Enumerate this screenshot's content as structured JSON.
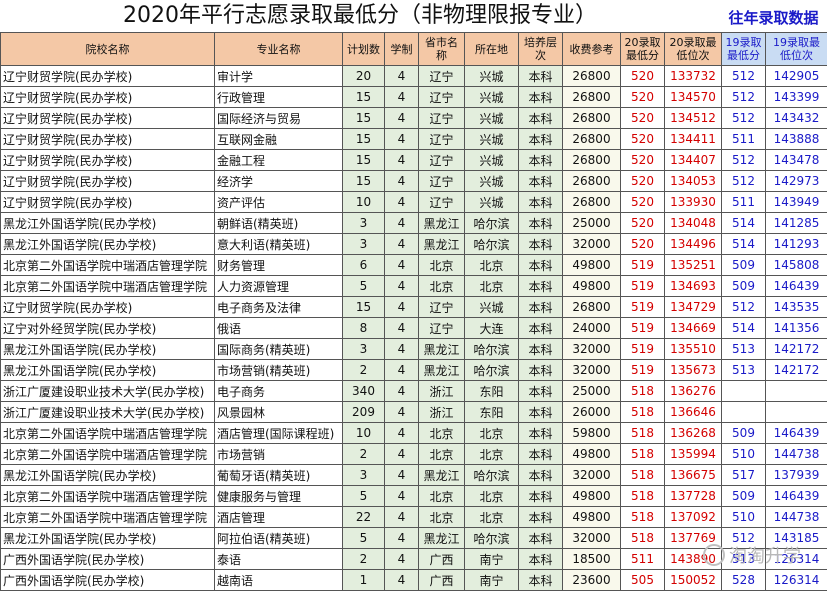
{
  "title": "2020年平行志愿录取最低分（非物理限报专业）",
  "corner_label": "往年录取数据",
  "headers": [
    "院校名称",
    "专业名称",
    "计划数",
    "学制",
    "省市名称",
    "所在地",
    "培养层次",
    "收费参考",
    "20录取最低分",
    "20录取最低位次",
    "19录取最低分",
    "19录取最低位次"
  ],
  "rows": [
    [
      "辽宁财贸学院(民办学校)",
      "审计学",
      "20",
      "4",
      "辽宁",
      "兴城",
      "本科",
      "26800",
      "520",
      "133732",
      "512",
      "142905"
    ],
    [
      "辽宁财贸学院(民办学校)",
      "行政管理",
      "15",
      "4",
      "辽宁",
      "兴城",
      "本科",
      "26800",
      "520",
      "134570",
      "512",
      "143399"
    ],
    [
      "辽宁财贸学院(民办学校)",
      "国际经济与贸易",
      "15",
      "4",
      "辽宁",
      "兴城",
      "本科",
      "26800",
      "520",
      "134512",
      "512",
      "143432"
    ],
    [
      "辽宁财贸学院(民办学校)",
      "互联网金融",
      "15",
      "4",
      "辽宁",
      "兴城",
      "本科",
      "26800",
      "520",
      "134411",
      "511",
      "143888"
    ],
    [
      "辽宁财贸学院(民办学校)",
      "金融工程",
      "15",
      "4",
      "辽宁",
      "兴城",
      "本科",
      "26800",
      "520",
      "134407",
      "512",
      "143478"
    ],
    [
      "辽宁财贸学院(民办学校)",
      "经济学",
      "15",
      "4",
      "辽宁",
      "兴城",
      "本科",
      "26800",
      "520",
      "134053",
      "512",
      "142973"
    ],
    [
      "辽宁财贸学院(民办学校)",
      "资产评估",
      "10",
      "4",
      "辽宁",
      "兴城",
      "本科",
      "26800",
      "520",
      "133930",
      "511",
      "143949"
    ],
    [
      "黑龙江外国语学院(民办学校)",
      "朝鲜语(精英班)",
      "3",
      "4",
      "黑龙江",
      "哈尔滨",
      "本科",
      "25000",
      "520",
      "134048",
      "514",
      "141285"
    ],
    [
      "黑龙江外国语学院(民办学校)",
      "意大利语(精英班)",
      "3",
      "4",
      "黑龙江",
      "哈尔滨",
      "本科",
      "32000",
      "520",
      "134496",
      "514",
      "141293"
    ],
    [
      "北京第二外国语学院中瑞酒店管理学院",
      "财务管理",
      "6",
      "4",
      "北京",
      "北京",
      "本科",
      "49800",
      "519",
      "135251",
      "509",
      "145808"
    ],
    [
      "北京第二外国语学院中瑞酒店管理学院",
      "人力资源管理",
      "5",
      "4",
      "北京",
      "北京",
      "本科",
      "49800",
      "519",
      "134693",
      "509",
      "146439"
    ],
    [
      "辽宁财贸学院(民办学校)",
      "电子商务及法律",
      "15",
      "4",
      "辽宁",
      "兴城",
      "本科",
      "26800",
      "519",
      "134729",
      "512",
      "143535"
    ],
    [
      "辽宁对外经贸学院(民办学校)",
      "俄语",
      "8",
      "4",
      "辽宁",
      "大连",
      "本科",
      "24000",
      "519",
      "134669",
      "514",
      "141356"
    ],
    [
      "黑龙江外国语学院(民办学校)",
      "国际商务(精英班)",
      "3",
      "4",
      "黑龙江",
      "哈尔滨",
      "本科",
      "32000",
      "519",
      "135510",
      "513",
      "142172"
    ],
    [
      "黑龙江外国语学院(民办学校)",
      "市场营销(精英班)",
      "2",
      "4",
      "黑龙江",
      "哈尔滨",
      "本科",
      "32000",
      "519",
      "135673",
      "513",
      "142172"
    ],
    [
      "浙江广厦建设职业技术大学(民办学校)",
      "电子商务",
      "340",
      "4",
      "浙江",
      "东阳",
      "本科",
      "25000",
      "518",
      "136276",
      "",
      ""
    ],
    [
      "浙江广厦建设职业技术大学(民办学校)",
      "风景园林",
      "209",
      "4",
      "浙江",
      "东阳",
      "本科",
      "26000",
      "518",
      "136646",
      "",
      ""
    ],
    [
      "北京第二外国语学院中瑞酒店管理学院",
      "酒店管理(国际课程班)",
      "10",
      "4",
      "北京",
      "北京",
      "本科",
      "59800",
      "518",
      "136268",
      "509",
      "146439"
    ],
    [
      "北京第二外国语学院中瑞酒店管理学院",
      "市场营销",
      "2",
      "4",
      "北京",
      "北京",
      "本科",
      "49800",
      "518",
      "135994",
      "510",
      "144738"
    ],
    [
      "黑龙江外国语学院(民办学校)",
      "葡萄牙语(精英班)",
      "3",
      "4",
      "黑龙江",
      "哈尔滨",
      "本科",
      "32000",
      "518",
      "136675",
      "517",
      "137939"
    ],
    [
      "北京第二外国语学院中瑞酒店管理学院",
      "健康服务与管理",
      "5",
      "4",
      "北京",
      "北京",
      "本科",
      "49800",
      "518",
      "137728",
      "509",
      "146439"
    ],
    [
      "北京第二外国语学院中瑞酒店管理学院",
      "酒店管理",
      "22",
      "4",
      "北京",
      "北京",
      "本科",
      "49800",
      "518",
      "137092",
      "510",
      "144738"
    ],
    [
      "黑龙江外国语学院(民办学校)",
      "阿拉伯语(精英班)",
      "5",
      "4",
      "黑龙江",
      "哈尔滨",
      "本科",
      "32000",
      "518",
      "137769",
      "512",
      "143185"
    ],
    [
      "广西外国语学院(民办学校)",
      "泰语",
      "2",
      "4",
      "广西",
      "南宁",
      "本科",
      "18500",
      "511",
      "143890",
      "513",
      "126314"
    ],
    [
      "广西外国语学院(民办学校)",
      "越南语",
      "1",
      "4",
      "广西",
      "南宁",
      "本科",
      "23600",
      "505",
      "150052",
      "528",
      "126314"
    ]
  ],
  "watermark": "淘淘升学",
  "watermark_icon": "wechat-logo-icon"
}
